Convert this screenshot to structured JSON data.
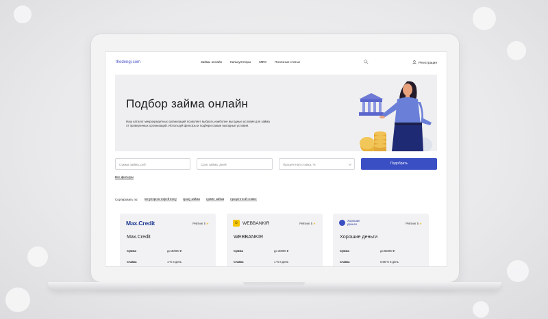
{
  "header": {
    "logo": "thedengi.com",
    "nav": [
      "Займы онлайн",
      "Калькуляторы",
      "МФО",
      "Полезные статьи"
    ],
    "register": "Регистрация"
  },
  "hero": {
    "title": "Подбор займа онлайн",
    "text": "Наш каталог микрокредитных организаций позволяет выбрать наиболее выгодные условия для займа от проверенных организаций. Используй фильтры и подбери самые выгодные условия."
  },
  "filters": {
    "amount_placeholder": "Сумма займа, руб",
    "term_placeholder": "Срок займа, дней",
    "rate_placeholder": "Процентная ставка, %",
    "submit": "Подобрать",
    "all_filters": "Все фильтры"
  },
  "sort": {
    "label": "Сортировать по:",
    "options": [
      "популярности/рейтингу",
      "сроку займа",
      "сумме займа",
      "процентной ставке"
    ]
  },
  "cards": [
    {
      "logo": "Max.Credit",
      "rating": "Рейтинг 5",
      "name": "Max.Credit",
      "sum_label": "Сумма",
      "sum": "до 30000 ₽",
      "rate_label": "Ставка",
      "rate": "1 % в день"
    },
    {
      "logo": "WEBBANKIR",
      "rating": "Рейтинг 5",
      "name": "WEBBANKIR",
      "sum_label": "Сумма",
      "sum": "до 30000 ₽",
      "rate_label": "Ставка",
      "rate": "1 % в день"
    },
    {
      "logo": "Хорошие деньги",
      "rating": "Рейтинг 5",
      "name": "Хорошие деньги",
      "sum_label": "Сумма",
      "sum": "до 55000 ₽",
      "rate_label": "Ставка",
      "rate": "0,65 % в день"
    }
  ],
  "colors": {
    "accent": "#3b4fc4",
    "star": "#f2b51d",
    "maxcredit_red": "#e8342d",
    "maxcredit_blue": "#1f3a93",
    "webbankir_yellow": "#f5c400"
  }
}
